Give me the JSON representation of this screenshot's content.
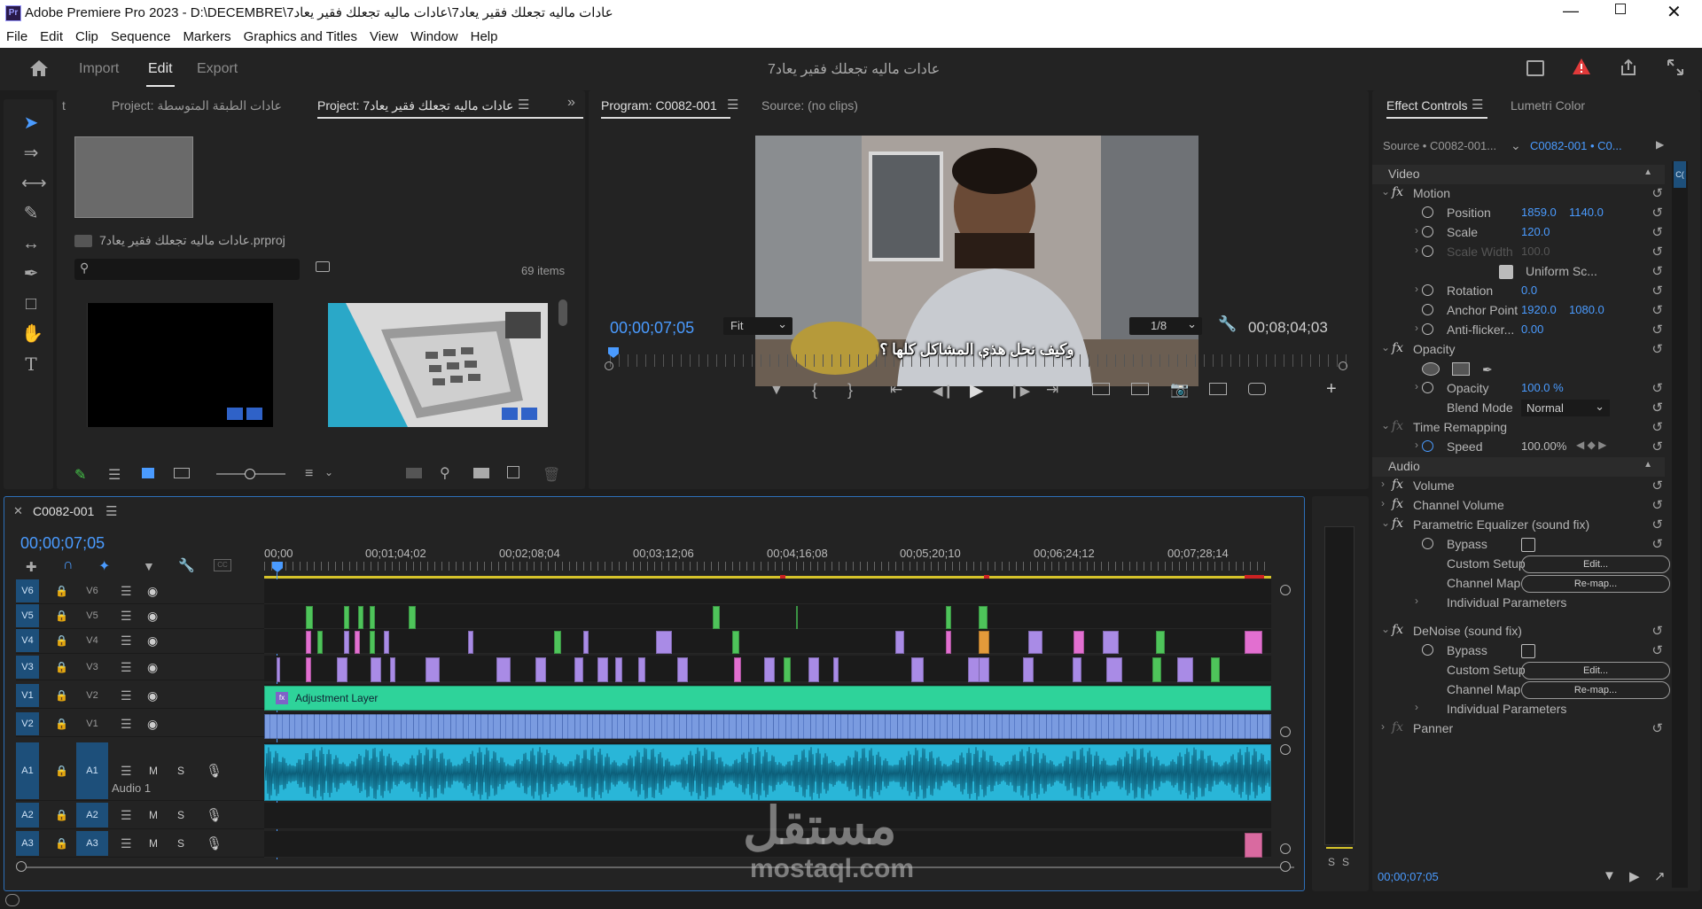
{
  "window": {
    "title": "Adobe Premiere Pro 2023 - D:\\DECEMBRE\\عادات ماليه تجعلك فقير يعاد7\\عادات ماليه تجعلك فقير يعاد7",
    "app_icon_label": "Pr"
  },
  "menu": [
    "File",
    "Edit",
    "Clip",
    "Sequence",
    "Markers",
    "Graphics and Titles",
    "View",
    "Window",
    "Help"
  ],
  "appbar": {
    "tabs": [
      "Import",
      "Edit",
      "Export"
    ],
    "active_tab": "Edit",
    "project_title": "عادات ماليه تجعلك فقير يعاد7"
  },
  "project_panel": {
    "tab1": "t",
    "tab2": "Project: عادات الطبقة المتوسطة",
    "tab3": "Project: عادات ماليه تجعلك فقير يعاد7",
    "file_name": "عادات ماليه تجعلك فقير يعاد7.prproj",
    "item_count": "69 items",
    "search_placeholder": ""
  },
  "program_monitor": {
    "tab": "Program: C0082-001",
    "source_tab": "Source: (no clips)",
    "subtitle": "وكيف نحل هذي المشاكل كلها ؟",
    "current_time": "00;00;07;05",
    "fit": "Fit",
    "resolution": "1/8",
    "duration": "00;08;04;03"
  },
  "effect_controls": {
    "tab": "Effect Controls",
    "tab2": "Lumetri Color",
    "source": "Source • C0082-001...",
    "target": "C0082-001 • C0...",
    "video": "Video",
    "motion": "Motion",
    "position_label": "Position",
    "position_x": "1859.0",
    "position_y": "1140.0",
    "scale_label": "Scale",
    "scale": "120.0",
    "scale_width_label": "Scale Width",
    "scale_width": "100.0",
    "uniform": "Uniform Sc...",
    "rotation_label": "Rotation",
    "rotation": "0.0",
    "anchor_label": "Anchor Point",
    "anchor_x": "1920.0",
    "anchor_y": "1080.0",
    "antiflicker_label": "Anti-flicker...",
    "antiflicker": "0.00",
    "opacity_group": "Opacity",
    "opacity_label": "Opacity",
    "opacity": "100.0 %",
    "blend_label": "Blend Mode",
    "blend": "Normal",
    "time_remap": "Time Remapping",
    "speed_label": "Speed",
    "speed": "100.00%",
    "audio": "Audio",
    "volume": "Volume",
    "channel_volume": "Channel Volume",
    "peq": "Parametric Equalizer (sound fix)",
    "bypass": "Bypass",
    "custom_setup": "Custom Setup",
    "edit_btn": "Edit...",
    "channel_map": "Channel Map",
    "remap_btn": "Re-map...",
    "individual": "Individual Parameters",
    "denoise": "DeNoise (sound fix)",
    "panner": "Panner",
    "footer_time": "00;00;07;05"
  },
  "timeline": {
    "sequence": "C0082-001",
    "timecode": "00;00;07;05",
    "ruler": [
      "00;00",
      "00;01;04;02",
      "00;02;08;04",
      "00;03;12;06",
      "00;04;16;08",
      "00;05;20;10",
      "00;06;24;12",
      "00;07;28;14"
    ],
    "video_tracks": [
      {
        "src": "V6",
        "tgt": "V6"
      },
      {
        "src": "V5",
        "tgt": "V5"
      },
      {
        "src": "V4",
        "tgt": "V4"
      },
      {
        "src": "V3",
        "tgt": "V3"
      },
      {
        "src": "V1",
        "tgt": "V2"
      },
      {
        "src": "V2",
        "tgt": "V1"
      }
    ],
    "audio_tracks": [
      {
        "src": "A1",
        "tgt": "A1",
        "name": "Audio 1"
      },
      {
        "src": "A2",
        "tgt": "A2"
      },
      {
        "src": "A3",
        "tgt": "A3"
      }
    ],
    "adjustment_layer": "Adjustment Layer",
    "mute": "M",
    "solo": "S"
  },
  "meter": {
    "s1": "S",
    "s2": "S"
  },
  "watermark": {
    "arabic": "مستقل",
    "latin": "mostaql.com"
  },
  "colors": {
    "accent": "#4a9bff",
    "adjustment": "#2ed39a",
    "clip_blue": "#7a9be0",
    "audio": "#29b6d8",
    "purple": "#a98be6",
    "pink": "#e26fd0",
    "green": "#4ec45a"
  }
}
